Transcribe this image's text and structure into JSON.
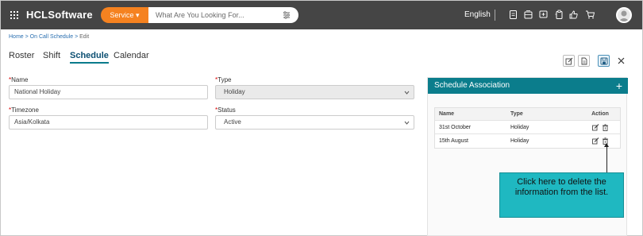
{
  "app": {
    "brand": "HCLSoftware",
    "service_label": "Service ▾",
    "search_placeholder": "What Are You Looking For...",
    "language": "English"
  },
  "breadcrumb": {
    "home": "Home",
    "sep": " > ",
    "section": "On Call Schedule",
    "current": "Edit"
  },
  "tabs": [
    "Roster",
    "Shift",
    "Schedule",
    "Calendar"
  ],
  "active_tab": "Schedule",
  "form": {
    "name_label": "Name",
    "name_value": "National Holiday",
    "type_label": "Type",
    "type_value": "Holiday",
    "timezone_label": "Timezone",
    "timezone_value": "Asia/Kolkata",
    "status_label": "Status",
    "status_value": "Active",
    "required_mark": "*"
  },
  "panel": {
    "title": "Schedule Association",
    "add_symbol": "+",
    "columns": [
      "Name",
      "Type",
      "Action"
    ],
    "rows": [
      {
        "name": "31st October",
        "type": "Holiday"
      },
      {
        "name": "15th August",
        "type": "Holiday"
      }
    ]
  },
  "callout": {
    "text": "Click here to delete the information from the list."
  },
  "colors": {
    "topbar": "#454545",
    "accent_orange": "#f58220",
    "teal": "#0b7d8c",
    "callout": "#1fb8c1"
  },
  "icons": [
    "grid-menu-icon",
    "filter-icon",
    "document-icon",
    "inbox-icon",
    "chat-plus-icon",
    "clipboard-icon",
    "thumbs-up-icon",
    "cart-icon",
    "edit-icon",
    "file-icon",
    "save-icon",
    "close-icon",
    "chevron-down-icon",
    "pencil-icon",
    "trash-icon"
  ]
}
